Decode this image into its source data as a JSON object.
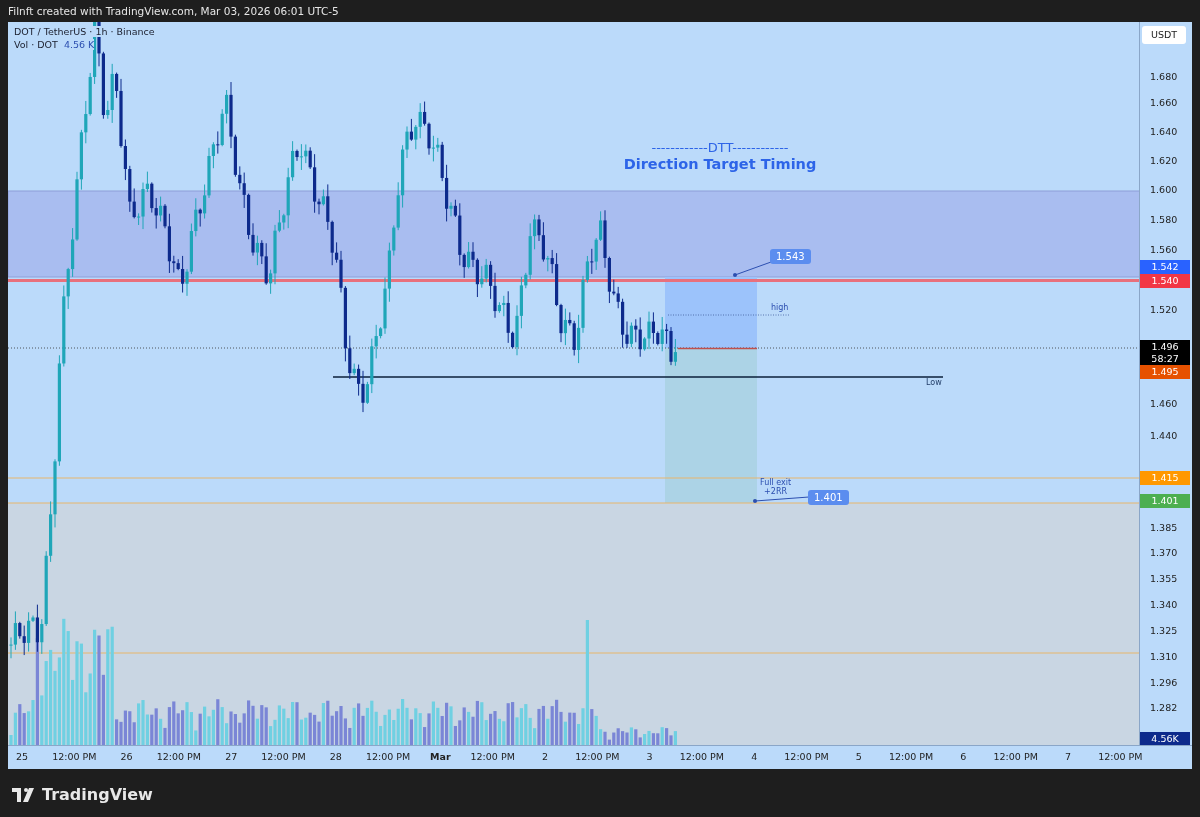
{
  "header": {
    "title": "Filnft created with TradingView.com, Mar 03, 2026 06:01 UTC-5"
  },
  "legend": {
    "symbol": "DOT / TetherUS · 1h · Binance",
    "volume_label": "Vol · DOT",
    "volume_value": "4.56 K"
  },
  "annotations": {
    "dtt_line": "------------DTT------------",
    "dtt_title": "Direction Target Timing",
    "high_label": "high",
    "low_label": "Low",
    "exit_label": "Full exit\n+2RR",
    "target_callout": "1.543",
    "stop_callout": "1.401"
  },
  "price_axis": {
    "currency": "USDT",
    "labels": [
      "1.680",
      "1.660",
      "1.640",
      "1.620",
      "1.600",
      "1.580",
      "1.560",
      "1.520",
      "1.460",
      "1.440",
      "1.385",
      "1.370",
      "1.355",
      "1.340",
      "1.325",
      "1.310",
      "1.296",
      "1.282"
    ],
    "tags": [
      {
        "text": "1.542",
        "color": "#2962ff"
      },
      {
        "text": "1.540",
        "color": "#f23645"
      },
      {
        "text": "1.496",
        "sub": "58:27",
        "color": "#000000"
      },
      {
        "text": "1.495",
        "color": "#e65100"
      },
      {
        "text": "1.415",
        "color": "#ff9800"
      },
      {
        "text": "1.401",
        "color": "#4caf50"
      },
      {
        "text": "4.56K",
        "color": "#0d2a8c"
      }
    ]
  },
  "time_axis": {
    "labels": [
      {
        "text": "25",
        "major": false
      },
      {
        "text": "12:00 PM",
        "major": false
      },
      {
        "text": "26",
        "major": false
      },
      {
        "text": "12:00 PM",
        "major": false
      },
      {
        "text": "27",
        "major": false
      },
      {
        "text": "12:00 PM",
        "major": false
      },
      {
        "text": "28",
        "major": false
      },
      {
        "text": "12:00 PM",
        "major": false
      },
      {
        "text": "Mar",
        "major": true
      },
      {
        "text": "12:00 PM",
        "major": false
      },
      {
        "text": "2",
        "major": false
      },
      {
        "text": "12:00 PM",
        "major": false
      },
      {
        "text": "3",
        "major": false
      },
      {
        "text": "12:00 PM",
        "major": false
      },
      {
        "text": "4",
        "major": false
      },
      {
        "text": "12:00 PM",
        "major": false
      },
      {
        "text": "5",
        "major": false
      },
      {
        "text": "12:00 PM",
        "major": false
      },
      {
        "text": "6",
        "major": false
      },
      {
        "text": "12:00 PM",
        "major": false
      },
      {
        "text": "7",
        "major": false
      },
      {
        "text": "12:00 PM",
        "major": false
      }
    ]
  },
  "footer": {
    "brand": "TradingView"
  }
}
